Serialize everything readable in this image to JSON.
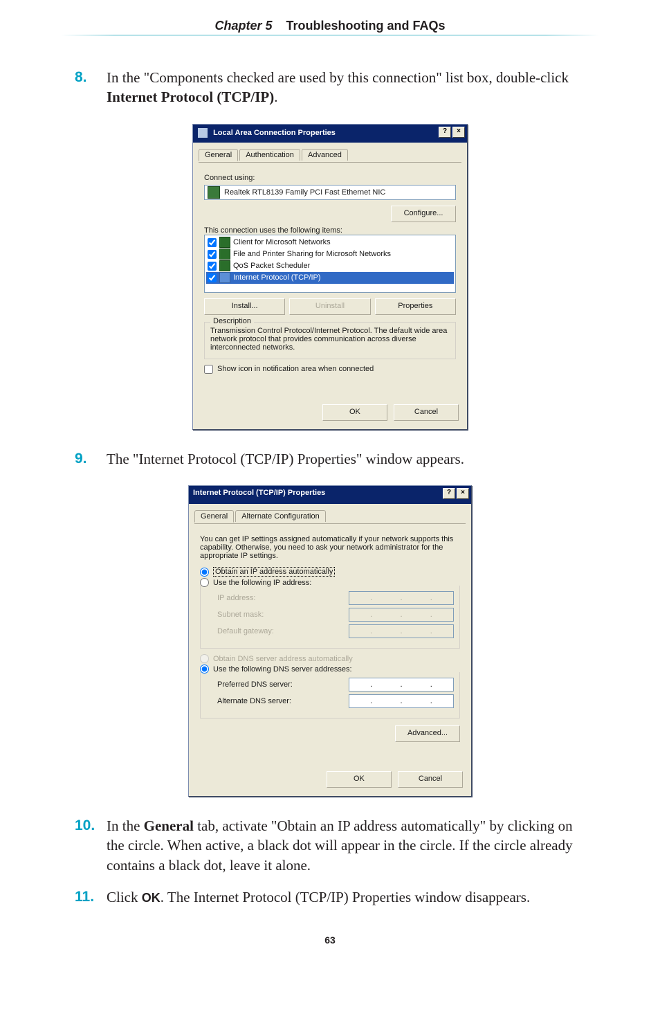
{
  "chapter": {
    "label": "Chapter 5",
    "title": "Troubleshooting and FAQs"
  },
  "steps": {
    "s8": {
      "num": "8.",
      "text_a": "In the \"Components checked are used by this connection\" list box, double-click ",
      "bold": "Internet Protocol (",
      "sc": "TCP/IP",
      "bold2": ")",
      "tail": "."
    },
    "s9": {
      "num": "9.",
      "text": "The \"Internet Protocol (",
      "sc": "TCP/IP",
      "text2": ") Properties\" window appears."
    },
    "s10": {
      "num": "10.",
      "text_a": "In the ",
      "bold": "General",
      "text_b": " tab, activate \"Obtain an IP address automatically\" by clicking on the circle. When active, a black dot will appear in the circle. If the circle already contains a black dot, leave it alone."
    },
    "s11": {
      "num": "11.",
      "text_a": "Click ",
      "sc": "OK",
      "text_b": ". The Internet Protocol (",
      "sc2": "TCP/IP",
      "text_c": ") Properties window disappears."
    }
  },
  "dlg1": {
    "title": "Local Area Connection Properties",
    "tabs": {
      "t1": "General",
      "t2": "Authentication",
      "t3": "Advanced"
    },
    "connect_label": "Connect using:",
    "nic": "Realtek RTL8139 Family PCI Fast Ethernet NIC",
    "configure": "Configure...",
    "uses_label": "This connection uses the following items:",
    "items": {
      "i1": "Client for Microsoft Networks",
      "i2": "File and Printer Sharing for Microsoft Networks",
      "i3": "QoS Packet Scheduler",
      "i4": "Internet Protocol (TCP/IP)"
    },
    "install": "Install...",
    "uninstall": "Uninstall",
    "properties": "Properties",
    "desc_label": "Description",
    "desc_text": "Transmission Control Protocol/Internet Protocol. The default wide area network protocol that provides communication across diverse interconnected networks.",
    "showicon": "Show icon in notification area when connected",
    "ok": "OK",
    "cancel": "Cancel"
  },
  "dlg2": {
    "title": "Internet Protocol (TCP/IP) Properties",
    "tabs": {
      "t1": "General",
      "t2": "Alternate Configuration"
    },
    "intro": "You can get IP settings assigned automatically if your network supports this capability. Otherwise, you need to ask your network administrator for the appropriate IP settings.",
    "r1": "Obtain an IP address automatically",
    "r2": "Use the following IP address:",
    "ip_label": "IP address:",
    "subnet_label": "Subnet mask:",
    "gw_label": "Default gateway:",
    "r3": "Obtain DNS server address automatically",
    "r4": "Use the following DNS server addresses:",
    "pdns": "Preferred DNS server:",
    "adns": "Alternate DNS server:",
    "advanced": "Advanced...",
    "ok": "OK",
    "cancel": "Cancel"
  },
  "pagenum": "63"
}
